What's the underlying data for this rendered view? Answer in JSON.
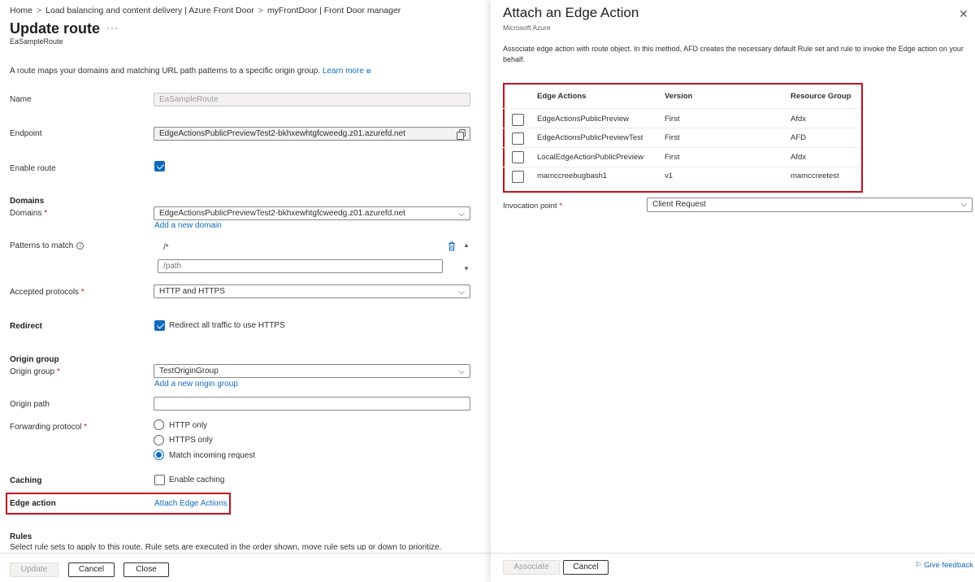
{
  "breadcrumb": [
    "Home",
    "Load balancing and content delivery | Azure Front Door",
    "myFrontDoor | Front Door manager"
  ],
  "page": {
    "title": "Update route",
    "more": "···",
    "subtitle": "EaSampleRoute",
    "intro": "A route maps your domains and matching URL path patterns to a specific origin group.",
    "learn_more": "Learn more"
  },
  "form": {
    "name_label": "Name",
    "name_value": "EaSampleRoute",
    "endpoint_label": "Endpoint",
    "endpoint_value": "EdgeActionsPublicPreviewTest2-bkhxewhtgfcweedg.z01.azurefd.net",
    "enable_route_label": "Enable route",
    "domains_section": "Domains",
    "domains_label": "Domains",
    "domains_value": "EdgeActionsPublicPreviewTest2-bkhxewhtgfcweedg.z01.azurefd.net",
    "add_domain": "Add a new domain",
    "patterns_label": "Patterns to match",
    "pattern_1": "/*",
    "pattern_placeholder": "/path",
    "protocols_label": "Accepted protocols",
    "protocols_value": "HTTP and HTTPS",
    "redirect_section": "Redirect",
    "redirect_option": "Redirect all traffic to use HTTPS",
    "origin_section": "Origin group",
    "origin_label": "Origin group",
    "origin_value": "TestOriginGroup",
    "add_origin": "Add a new origin group",
    "origin_path_label": "Origin path",
    "forwarding_label": "Forwarding protocol",
    "forwarding_options": [
      "HTTP only",
      "HTTPS only",
      "Match incoming request"
    ],
    "caching_section": "Caching",
    "caching_option": "Enable caching",
    "edge_action_label": "Edge action",
    "edge_action_link": "Attach Edge Actions",
    "rules_section": "Rules",
    "rules_desc": "Select rule sets to apply to this route. Rule sets are executed in the order shown, move rule sets up or down to prioritize."
  },
  "left_footer": {
    "update": "Update",
    "cancel": "Cancel",
    "close": "Close"
  },
  "panel": {
    "title": "Attach an Edge Action",
    "subtitle": "Microsoft Azure",
    "close": "✕",
    "description": "Associate edge action with route object. In this method, AFD creates the necessary default Rule set and rule to invoke the Edge action on your behalf.",
    "columns": [
      "Edge Actions",
      "Version",
      "Resource Group"
    ],
    "rows": [
      {
        "name": "EdgeActionsPublicPreview",
        "version": "First",
        "group": "Afdx"
      },
      {
        "name": "EdgeActionsPublicPreviewTest",
        "version": "First",
        "group": "AFD"
      },
      {
        "name": "LocalEdgeActionPublicPreview",
        "version": "First",
        "group": "Afdx"
      },
      {
        "name": "mamccreebugbash1",
        "version": "v1",
        "group": "mamccreetest"
      }
    ],
    "invocation_label": "Invocation point",
    "invocation_value": "Client Request",
    "associate": "Associate",
    "cancel": "Cancel",
    "feedback": "Give feedback"
  }
}
